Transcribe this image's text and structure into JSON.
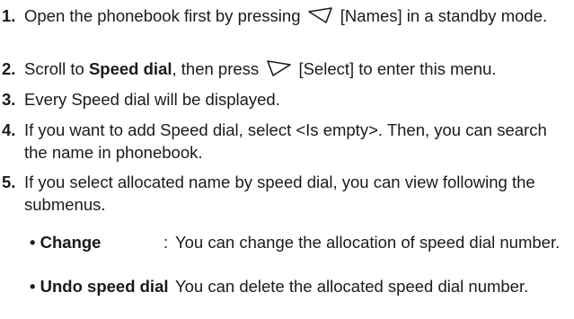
{
  "steps": [
    {
      "num": "1.",
      "text_before": "Open the phonebook first by pressing",
      "softkey_icon": "left-softkey-icon",
      "text_after": "[Names] in a standby mode."
    },
    {
      "num": "2.",
      "text_before": "Scroll to",
      "bold": "Speed dial",
      "text_mid": ", then press",
      "softkey_icon": "right-softkey-icon",
      "text_after": "[Select] to enter this menu."
    },
    {
      "num": "3.",
      "text": "Every Speed dial will be displayed."
    },
    {
      "num": "4.",
      "text": "If you want to add Speed dial, select <Is empty>. Then, you can search the name in phonebook."
    },
    {
      "num": "5.",
      "text": "If you select allocated name by speed dial, you can view following the submenus."
    }
  ],
  "submenus": [
    {
      "bullet": "•",
      "term": "Change",
      "colon": ":",
      "desc": "You can change the allocation of speed dial number."
    },
    {
      "bullet": "•",
      "term": "Undo speed dial",
      "colon": ":",
      "desc": "You can delete the allocated speed dial number."
    }
  ]
}
